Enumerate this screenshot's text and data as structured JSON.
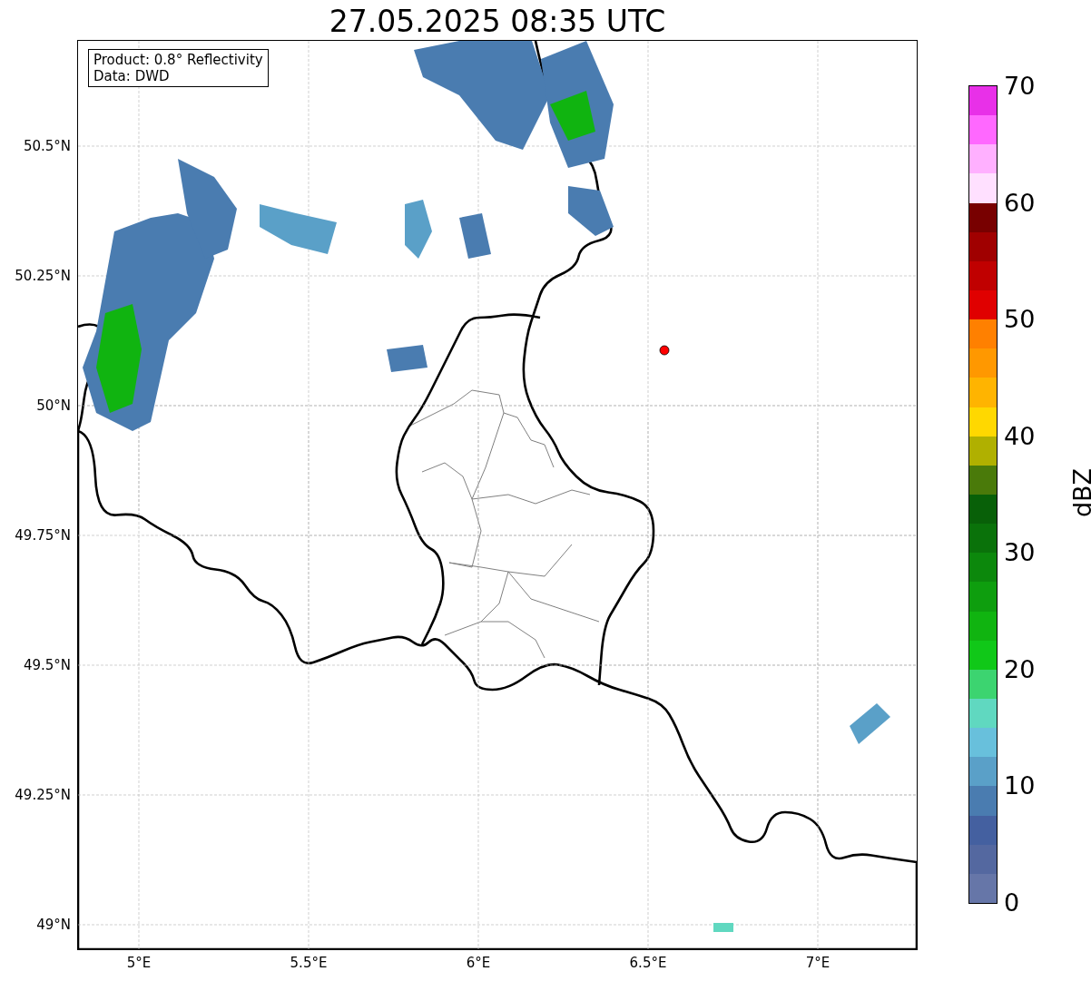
{
  "title": "27.05.2025 08:35 UTC",
  "map": {
    "info_box": [
      "Product: 0.8° Reflectivity",
      "Data: DWD"
    ],
    "lat_labels": [
      "50.5°N",
      "50.25°N",
      "50°N",
      "49.75°N",
      "49.5°N",
      "49.25°N",
      "49°N"
    ],
    "lon_labels": [
      "5°E",
      "5.5°E",
      "6°E",
      "6.5°E",
      "7°E"
    ]
  },
  "colorbar": {
    "label": "dBZ",
    "ticks": [
      "70",
      "60",
      "50",
      "40",
      "30",
      "20",
      "10",
      "0"
    ],
    "bands": [
      {
        "color": "#e830e8"
      },
      {
        "color": "#ff68ff"
      },
      {
        "color": "#ffb0ff"
      },
      {
        "color": "#ffe0ff"
      },
      {
        "color": "#780000"
      },
      {
        "color": "#a00000"
      },
      {
        "color": "#c00000"
      },
      {
        "color": "#e00000"
      },
      {
        "color": "#ff8000"
      },
      {
        "color": "#ff9800"
      },
      {
        "color": "#ffb400"
      },
      {
        "color": "#ffd800"
      },
      {
        "color": "#b0b000"
      },
      {
        "color": "#4a7a0a"
      },
      {
        "color": "#086008"
      },
      {
        "color": "#0a720a"
      },
      {
        "color": "#0c880c"
      },
      {
        "color": "#0e9e0e"
      },
      {
        "color": "#10b410"
      },
      {
        "color": "#10c818"
      },
      {
        "color": "#3cd470"
      },
      {
        "color": "#60d8c0"
      },
      {
        "color": "#68c0dc"
      },
      {
        "color": "#5aa0c8"
      },
      {
        "color": "#4a7cb0"
      },
      {
        "color": "#4460a0"
      },
      {
        "color": "#5468a0"
      },
      {
        "color": "#6676a8"
      }
    ]
  }
}
